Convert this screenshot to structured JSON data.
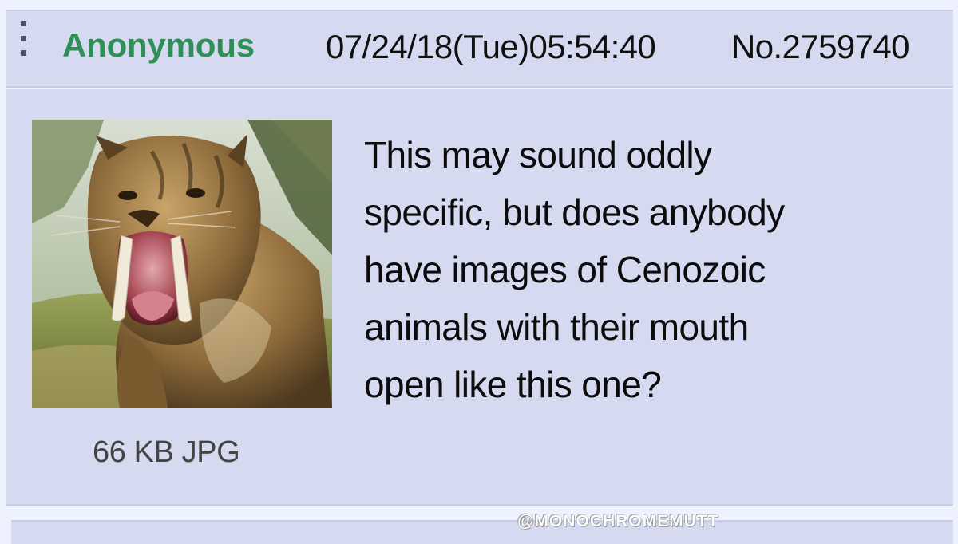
{
  "post": {
    "poster_name": "Anonymous",
    "date": "07/24/18(Tue)05:54:40",
    "number": "No.2759740",
    "file_info": "66 KB JPG",
    "message_lines": [
      "This may sound oddly",
      "specific, but does anybody",
      "have images of Cenozoic",
      "animals with their mouth",
      "open like this one?"
    ],
    "thumbnail_icon": "saber-tooth-cat-image"
  },
  "watermark": "@MONOCHROMEMUTT",
  "colors": {
    "post_background": "#d6daf0",
    "page_background": "#eef2ff",
    "poster_name": "#2f8f57",
    "text": "#101010"
  }
}
